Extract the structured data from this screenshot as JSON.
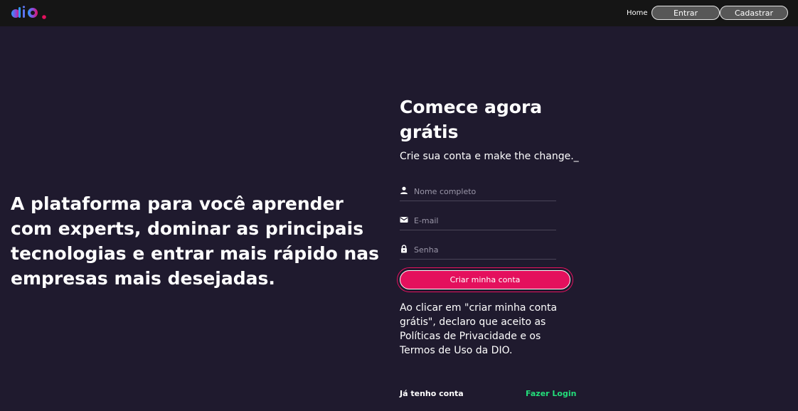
{
  "navbar": {
    "logo_icon": "dio-logo",
    "home_label": "Home",
    "login_label": "Entrar",
    "signup_label": "Cadastrar"
  },
  "hero": {
    "headline": "A plataforma para você aprender com experts, dominar as principais tecnologias e entrar mais rápido nas empresas mais desejadas."
  },
  "form": {
    "title": "Comece agora grátis",
    "subtitle": "Crie sua conta e make the change._",
    "name_placeholder": "Nome completo",
    "name_value": "",
    "email_placeholder": "E-mail",
    "email_value": "",
    "password_placeholder": "Senha",
    "password_value": "",
    "submit_label": "Criar minha conta",
    "terms_text": "Ao clicar em \"criar minha conta grátis\", declaro que aceito as Políticas de Privacidade e os Termos de Uso da DIO.",
    "have_account_label": "Já tenho conta",
    "login_link_label": "Fazer Login"
  },
  "colors": {
    "background": "#1f1a2e",
    "navbar": "#151515",
    "accent": "#e4105d",
    "link": "#23dd7a"
  },
  "icons": {
    "name_field": "person-icon",
    "email_field": "email-icon",
    "password_field": "lock-icon"
  }
}
